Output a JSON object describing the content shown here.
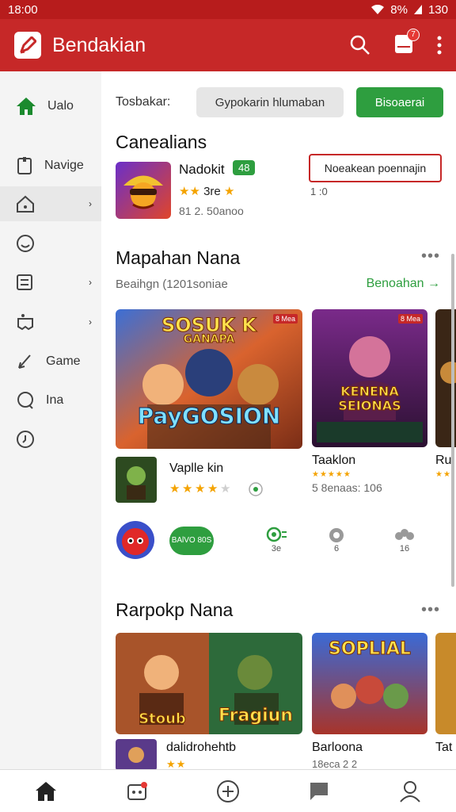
{
  "status_bar": {
    "time": "18:00",
    "battery": "8%",
    "right_text": "130"
  },
  "app_bar": {
    "title": "Bendakian",
    "badge_count": "7"
  },
  "sidebar": {
    "items": [
      {
        "label": "Ualo",
        "icon": "home-icon",
        "active": false
      },
      {
        "label": "Navige",
        "icon": "bookmark-icon",
        "active": false
      },
      {
        "label": "",
        "icon": "house-outline-icon",
        "active": true
      },
      {
        "label": "",
        "icon": "smile-icon",
        "active": false
      },
      {
        "label": "",
        "icon": "list-icon",
        "active": false
      },
      {
        "label": "",
        "icon": "gamepad-icon",
        "active": false
      },
      {
        "label": "Game",
        "icon": "pen-icon",
        "active": false
      },
      {
        "label": "Ina",
        "icon": "chat-icon",
        "active": false
      },
      {
        "label": "",
        "icon": "support-icon",
        "active": false
      }
    ]
  },
  "filter": {
    "label": "Tosbakar:",
    "input_value": "Gypokarin hlumaban",
    "button_label": "Bisoaerai"
  },
  "featured": {
    "section_title": "Canealians",
    "name": "Nadokit",
    "tag": "48",
    "rating_text": "3re",
    "meta": "81 2. 50anoo",
    "action_label": "Noeakean poennajin",
    "tiny_text": "1 :0"
  },
  "section1": {
    "title": "Mapahan Nana",
    "subtitle": "Beaihgn  (1201soniae",
    "see_all": "Benoahan",
    "cards": [
      {
        "art_title_top": "SOSUK K",
        "art_title_mid": "GANAPA",
        "art_title_bottom": "PayGOSION",
        "corner_label": "8 Mea"
      },
      {
        "art_title_top": "KENENA",
        "art_title_bottom": "SEIONAS",
        "corner_label": "8 Mea"
      }
    ],
    "list_item": {
      "name": "Vaplle kin",
      "rating_value": 3.5
    },
    "card2_caption": {
      "name": "Taaklon",
      "meta": "5 8enaas: 106"
    },
    "partial_caption": "Ru"
  },
  "icon_row": {
    "pill_label": "BAlVO 80S",
    "stats": [
      "3e",
      "6",
      "16"
    ]
  },
  "section2": {
    "title": "Rarpokp Nana",
    "cards": [
      {
        "art_title_left": "Stoub",
        "art_title_right": "Fragiun"
      },
      {
        "art_title": "SOPLIAL"
      }
    ],
    "captions": [
      {
        "name": "dalidrohehtb"
      },
      {
        "name": "Barloona",
        "meta": "18eca 2 2"
      },
      {
        "name": "Tat"
      }
    ]
  },
  "bottom_nav": {
    "items": [
      "home-icon",
      "game-icon",
      "add-icon",
      "chat-icon",
      "profile-icon"
    ]
  }
}
